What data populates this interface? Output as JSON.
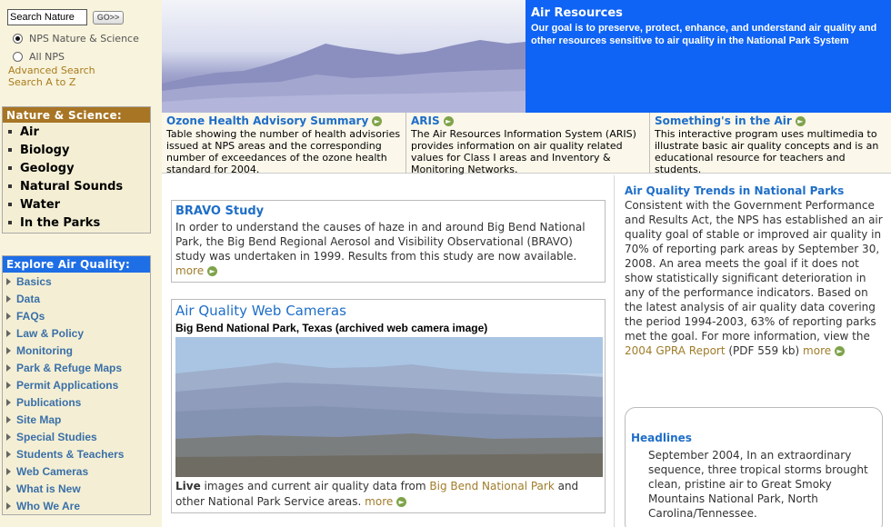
{
  "search": {
    "value": "Search Nature",
    "go_label": "GO>>"
  },
  "scope_options": [
    {
      "label": "NPS Nature & Science",
      "selected": true
    },
    {
      "label": "All NPS",
      "selected": false
    }
  ],
  "links": {
    "advanced": "Advanced Search",
    "atoz": "Search A to Z"
  },
  "nature_nav": {
    "heading": "Nature & Science:",
    "items": [
      "Air",
      "Biology",
      "Geology",
      "Natural Sounds",
      "Water",
      "In the Parks"
    ]
  },
  "explore_nav": {
    "heading": "Explore Air Quality:",
    "items": [
      "Basics",
      "Data",
      "FAQs",
      "Law & Policy",
      "Monitoring",
      "Park & Refuge Maps",
      "Permit Applications",
      "Publications",
      "Site Map",
      "Special Studies",
      "Students & Teachers",
      "Web Cameras",
      "What is New",
      "Who We Are"
    ]
  },
  "banner": {
    "title": "Air Resources",
    "subtitle": "Our goal is to preserve, protect, enhance, and understand air quality and other resources sensitive to air quality in the National Park System"
  },
  "features": [
    {
      "title": "Ozone Health Advisory Summary",
      "desc": "Table showing the number of health advisories issued at NPS areas and the corresponding number of exceedances of the ozone health standard for 2004."
    },
    {
      "title": "ARIS",
      "desc": "The Air Resources Information System (ARIS) provides information on air quality related values for Class I areas and Inventory & Monitoring Networks."
    },
    {
      "title": "Something's in the Air",
      "desc": "This interactive program uses multimedia to illustrate basic air quality concepts and is an educational resource for teachers and students."
    }
  ],
  "bravo": {
    "title": "BRAVO Study",
    "text": "In order to understand the causes of haze in and around Big Bend National Park, the Big Bend Regional Aerosol and Visibility Observational (BRAVO) study was undertaken in 1999. Results from this study are now available. ",
    "more": "more"
  },
  "webcam": {
    "title": "Air Quality Web Cameras",
    "caption": "Big Bend National Park, Texas (archived web camera image)",
    "text_bold": "Live",
    "text_1": " images and current air quality data from ",
    "park_link": "Big Bend National Park",
    "text_2": " and other National Park Service areas. ",
    "more": "more"
  },
  "trends": {
    "title": "Air Quality Trends in National Parks",
    "text": "Consistent with the Government Performance and Results Act, the NPS has established an air quality goal of stable or improved air quality in 70% of reporting park areas by September 30, 2008. An area meets the goal if it does not show statistically significant deterioration in any of the performance indicators. Based on the latest analysis of air quality data covering the period 1994-2003, 63% of reporting parks met the goal. For more information, view the ",
    "link": "2004 GPRA Report",
    "text_after": " (PDF 559 kb) ",
    "more": "more"
  },
  "headlines": {
    "title": "Headlines",
    "text": "September 2004, In an extraordinary sequence, three tropical storms brought clean, pristine air to Great Smoky Mountains National Park, North Carolina/Tennessee."
  },
  "colors": {
    "accent_blue": "#1e6ec8",
    "banner_blue": "#0f63f5",
    "nav_brown": "#a87525",
    "link_olive": "#a07c2a",
    "sidebar_bg": "#f8f3dc"
  }
}
